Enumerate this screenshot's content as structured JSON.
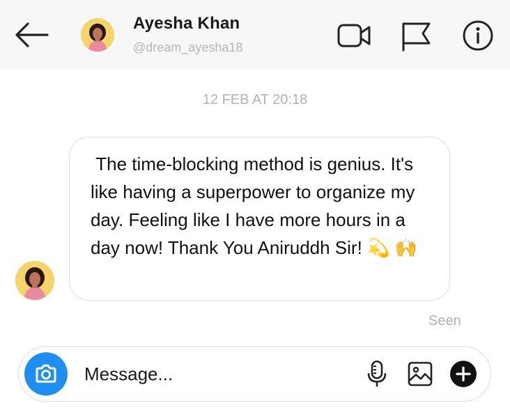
{
  "header": {
    "name": "Ayesha Khan",
    "handle": "@dream_ayesha18",
    "back_icon": "arrow-left-icon",
    "actions": [
      "video-camera-icon",
      "flag-icon",
      "info-icon"
    ]
  },
  "conversation": {
    "timestamp": "12 FEB AT 20:18",
    "message": " The time-blocking method is genius. It's like having a superpower to organize my day. Feeling like I have more hours in a day now! Thank You Aniruddh Sir! 💫 🙌",
    "status": "Seen"
  },
  "composer": {
    "placeholder": "Message...",
    "camera_icon": "camera-icon",
    "icons": [
      "microphone-icon",
      "gallery-icon",
      "plus-circle-icon"
    ],
    "accent_color": "#1e8ef0"
  }
}
